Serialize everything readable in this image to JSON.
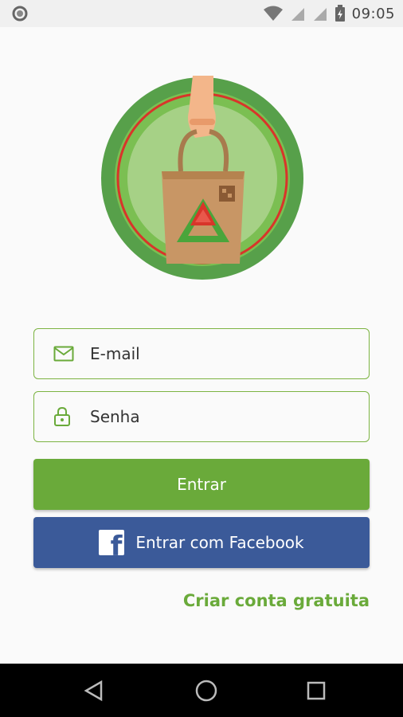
{
  "status_bar": {
    "time": "09:05"
  },
  "login": {
    "email_placeholder": "E-mail",
    "password_placeholder": "Senha",
    "login_button": "Entrar",
    "facebook_button": "Entrar com Facebook",
    "create_account_link": "Criar conta gratuita"
  },
  "icons": {
    "email": "envelope-icon",
    "password": "lock-icon",
    "facebook": "facebook-logo-icon",
    "nav_back": "back-triangle-icon",
    "nav_home": "home-circle-icon",
    "nav_recents": "recents-square-icon"
  },
  "colors": {
    "accent_green": "#6aaa3a",
    "facebook_blue": "#3b5a99",
    "border_green": "#7cb342"
  }
}
